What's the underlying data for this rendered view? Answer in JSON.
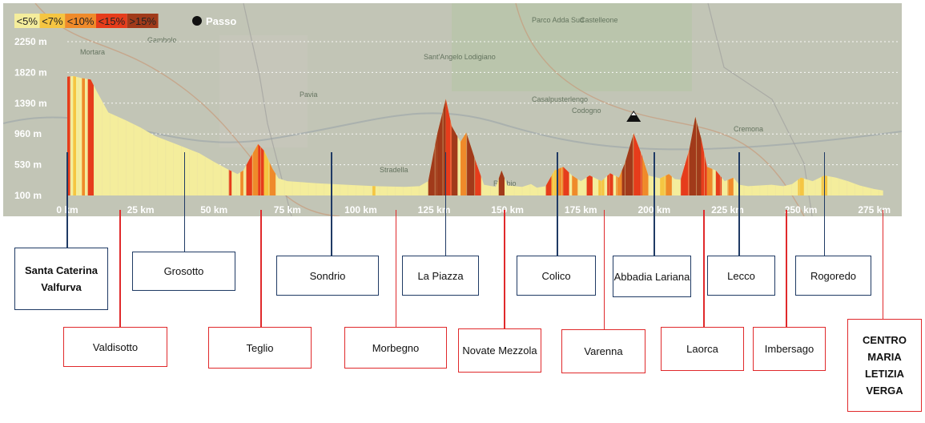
{
  "chart_data": {
    "type": "area",
    "title": "",
    "xlabel": "",
    "ylabel": "",
    "x_unit": "km",
    "y_unit": "m",
    "xlim": [
      0,
      280
    ],
    "ylim": [
      0,
      2450
    ],
    "x_ticks": [
      0,
      25,
      50,
      75,
      100,
      125,
      150,
      175,
      200,
      225,
      250,
      275
    ],
    "x_tick_labels": [
      "0 km",
      "25 km",
      "50 km",
      "75 km",
      "100 km",
      "125 km",
      "150 km",
      "175 km",
      "200 km",
      "225 km",
      "250 km",
      "275 km"
    ],
    "y_ticks": [
      100,
      530,
      960,
      1390,
      1820,
      2250
    ],
    "y_tick_labels": [
      "100 m",
      "530 m",
      "960 m",
      "1390 m",
      "1820 m",
      "2250 m"
    ],
    "gridlines": "horizontal dotted",
    "legend_position": "top-left",
    "legend": [
      {
        "label": "<5%",
        "color": "#f4ed9c"
      },
      {
        "label": "<7%",
        "color": "#f5c542"
      },
      {
        "label": "<10%",
        "color": "#ef8a2a"
      },
      {
        "label": "<15%",
        "color": "#e63c1b"
      },
      {
        "label": ">15%",
        "color": "#a13a1a"
      }
    ],
    "pass_marker_label": "Passo",
    "pass_marker_km": 193,
    "elevation_profile": [
      {
        "km": 0,
        "m": 1760
      },
      {
        "km": 2,
        "m": 1770
      },
      {
        "km": 5,
        "m": 1740
      },
      {
        "km": 8,
        "m": 1720
      },
      {
        "km": 10,
        "m": 1560
      },
      {
        "km": 14,
        "m": 1260
      },
      {
        "km": 20,
        "m": 1150
      },
      {
        "km": 25,
        "m": 1050
      },
      {
        "km": 30,
        "m": 930
      },
      {
        "km": 37,
        "m": 820
      },
      {
        "km": 45,
        "m": 690
      },
      {
        "km": 50,
        "m": 570
      },
      {
        "km": 55,
        "m": 460
      },
      {
        "km": 58,
        "m": 400
      },
      {
        "km": 60,
        "m": 450
      },
      {
        "km": 62,
        "m": 600
      },
      {
        "km": 65,
        "m": 820
      },
      {
        "km": 67,
        "m": 730
      },
      {
        "km": 70,
        "m": 470
      },
      {
        "km": 72,
        "m": 340
      },
      {
        "km": 75,
        "m": 300
      },
      {
        "km": 85,
        "m": 270
      },
      {
        "km": 95,
        "m": 250
      },
      {
        "km": 105,
        "m": 230
      },
      {
        "km": 115,
        "m": 220
      },
      {
        "km": 120,
        "m": 230
      },
      {
        "km": 123,
        "m": 300
      },
      {
        "km": 126,
        "m": 950
      },
      {
        "km": 129,
        "m": 1450
      },
      {
        "km": 131,
        "m": 1070
      },
      {
        "km": 134,
        "m": 850
      },
      {
        "km": 136,
        "m": 980
      },
      {
        "km": 139,
        "m": 600
      },
      {
        "km": 142,
        "m": 250
      },
      {
        "km": 146,
        "m": 220
      },
      {
        "km": 148,
        "m": 450
      },
      {
        "km": 150,
        "m": 240
      },
      {
        "km": 155,
        "m": 220
      },
      {
        "km": 158,
        "m": 260
      },
      {
        "km": 160,
        "m": 210
      },
      {
        "km": 163,
        "m": 230
      },
      {
        "km": 166,
        "m": 450
      },
      {
        "km": 169,
        "m": 500
      },
      {
        "km": 172,
        "m": 380
      },
      {
        "km": 175,
        "m": 300
      },
      {
        "km": 178,
        "m": 380
      },
      {
        "km": 182,
        "m": 300
      },
      {
        "km": 185,
        "m": 410
      },
      {
        "km": 188,
        "m": 350
      },
      {
        "km": 190,
        "m": 550
      },
      {
        "km": 193,
        "m": 970
      },
      {
        "km": 196,
        "m": 640
      },
      {
        "km": 198,
        "m": 380
      },
      {
        "km": 202,
        "m": 340
      },
      {
        "km": 205,
        "m": 400
      },
      {
        "km": 207,
        "m": 330
      },
      {
        "km": 209,
        "m": 320
      },
      {
        "km": 212,
        "m": 750
      },
      {
        "km": 214,
        "m": 1200
      },
      {
        "km": 216,
        "m": 900
      },
      {
        "km": 218,
        "m": 500
      },
      {
        "km": 221,
        "m": 450
      },
      {
        "km": 224,
        "m": 300
      },
      {
        "km": 227,
        "m": 350
      },
      {
        "km": 229,
        "m": 250
      },
      {
        "km": 232,
        "m": 230
      },
      {
        "km": 236,
        "m": 240
      },
      {
        "km": 240,
        "m": 250
      },
      {
        "km": 244,
        "m": 230
      },
      {
        "km": 247,
        "m": 260
      },
      {
        "km": 250,
        "m": 350
      },
      {
        "km": 254,
        "m": 300
      },
      {
        "km": 258,
        "m": 380
      },
      {
        "km": 262,
        "m": 350
      },
      {
        "km": 266,
        "m": 300
      },
      {
        "km": 270,
        "m": 240
      },
      {
        "km": 275,
        "m": 190
      },
      {
        "km": 278,
        "m": 170
      }
    ],
    "steep_bands": [
      {
        "from": 0,
        "to": 1,
        "color": "#e63c1b"
      },
      {
        "from": 2,
        "to": 3,
        "color": "#f5c542"
      },
      {
        "from": 5,
        "to": 6,
        "color": "#ef8a2a"
      },
      {
        "from": 7,
        "to": 9,
        "color": "#e63c1b"
      },
      {
        "from": 55,
        "to": 56,
        "color": "#e63c1b"
      },
      {
        "from": 59,
        "to": 60,
        "color": "#ef8a2a"
      },
      {
        "from": 61,
        "to": 63,
        "color": "#e63c1b"
      },
      {
        "from": 63,
        "to": 65,
        "color": "#ef8a2a"
      },
      {
        "from": 65,
        "to": 67,
        "color": "#e63c1b"
      },
      {
        "from": 67,
        "to": 69,
        "color": "#f5c542"
      },
      {
        "from": 69,
        "to": 71,
        "color": "#ef8a2a"
      },
      {
        "from": 104,
        "to": 105,
        "color": "#f5c542"
      },
      {
        "from": 123,
        "to": 126,
        "color": "#a13a1a"
      },
      {
        "from": 126,
        "to": 129,
        "color": "#a13a1a"
      },
      {
        "from": 129,
        "to": 131,
        "color": "#e63c1b"
      },
      {
        "from": 131,
        "to": 133,
        "color": "#a13a1a"
      },
      {
        "from": 134,
        "to": 136,
        "color": "#ef8a2a"
      },
      {
        "from": 136,
        "to": 139,
        "color": "#a13a1a"
      },
      {
        "from": 139,
        "to": 141,
        "color": "#e63c1b"
      },
      {
        "from": 147,
        "to": 149,
        "color": "#a13a1a"
      },
      {
        "from": 163,
        "to": 165,
        "color": "#e63c1b"
      },
      {
        "from": 165,
        "to": 167,
        "color": "#f5c542"
      },
      {
        "from": 167,
        "to": 169,
        "color": "#ef8a2a"
      },
      {
        "from": 169,
        "to": 171,
        "color": "#e63c1b"
      },
      {
        "from": 172,
        "to": 174,
        "color": "#ef8a2a"
      },
      {
        "from": 177,
        "to": 179,
        "color": "#e63c1b"
      },
      {
        "from": 181,
        "to": 183,
        "color": "#f5c542"
      },
      {
        "from": 184,
        "to": 186,
        "color": "#e63c1b"
      },
      {
        "from": 187,
        "to": 189,
        "color": "#ef8a2a"
      },
      {
        "from": 189,
        "to": 193,
        "color": "#a13a1a"
      },
      {
        "from": 193,
        "to": 196,
        "color": "#e63c1b"
      },
      {
        "from": 196,
        "to": 198,
        "color": "#ef8a2a"
      },
      {
        "from": 202,
        "to": 204,
        "color": "#f5c542"
      },
      {
        "from": 204,
        "to": 206,
        "color": "#ef8a2a"
      },
      {
        "from": 209,
        "to": 212,
        "color": "#e63c1b"
      },
      {
        "from": 212,
        "to": 216,
        "color": "#a13a1a"
      },
      {
        "from": 216,
        "to": 218,
        "color": "#e63c1b"
      },
      {
        "from": 218,
        "to": 220,
        "color": "#ef8a2a"
      },
      {
        "from": 221,
        "to": 223,
        "color": "#e63c1b"
      },
      {
        "from": 225,
        "to": 227,
        "color": "#ef8a2a"
      },
      {
        "from": 249,
        "to": 251,
        "color": "#f5c542"
      },
      {
        "from": 257,
        "to": 259,
        "color": "#f5c542"
      }
    ],
    "map_place_names": [
      "Parco Adda Sud",
      "Castelleone",
      "Mortara",
      "Gambolo",
      "Pavia",
      "Sant'Angelo Lodigiano",
      "Casalpusterlengo",
      "Codogno",
      "Cremona",
      "Stradella",
      "Robbio"
    ]
  },
  "locations": [
    {
      "name": "Santa Caterina Valfurva",
      "km": 0,
      "bold": true,
      "style": "blue",
      "row": "top"
    },
    {
      "name": "Valdisotto",
      "km": 18,
      "bold": false,
      "style": "red",
      "row": "bottom"
    },
    {
      "name": "Grosotto",
      "km": 40,
      "bold": false,
      "style": "blue",
      "row": "top"
    },
    {
      "name": "Teglio",
      "km": 66,
      "bold": false,
      "style": "red",
      "row": "bottom"
    },
    {
      "name": "Sondrio",
      "km": 90,
      "bold": false,
      "style": "blue",
      "row": "top"
    },
    {
      "name": "Morbegno",
      "km": 112,
      "bold": false,
      "style": "red",
      "row": "bottom"
    },
    {
      "name": "La Piazza",
      "km": 129,
      "bold": false,
      "style": "blue",
      "row": "top"
    },
    {
      "name": "Novate Mezzola",
      "km": 149,
      "bold": false,
      "style": "red",
      "row": "bottom"
    },
    {
      "name": "Colico",
      "km": 167,
      "bold": false,
      "style": "blue",
      "row": "top"
    },
    {
      "name": "Varenna",
      "km": 183,
      "bold": false,
      "style": "red",
      "row": "bottom"
    },
    {
      "name": "Abbadia Lariana",
      "km": 200,
      "bold": false,
      "style": "blue",
      "row": "top"
    },
    {
      "name": "Laorca",
      "km": 217,
      "bold": false,
      "style": "red",
      "row": "bottom"
    },
    {
      "name": "Lecco",
      "km": 229,
      "bold": false,
      "style": "blue",
      "row": "top"
    },
    {
      "name": "Imbersago",
      "km": 245,
      "bold": false,
      "style": "red",
      "row": "bottom"
    },
    {
      "name": "Rogoredo",
      "km": 258,
      "bold": false,
      "style": "blue",
      "row": "top"
    },
    {
      "name": "CENTRO MARIA LETIZIA VERGA",
      "km": 278,
      "bold": true,
      "style": "red",
      "row": "bottom"
    }
  ]
}
